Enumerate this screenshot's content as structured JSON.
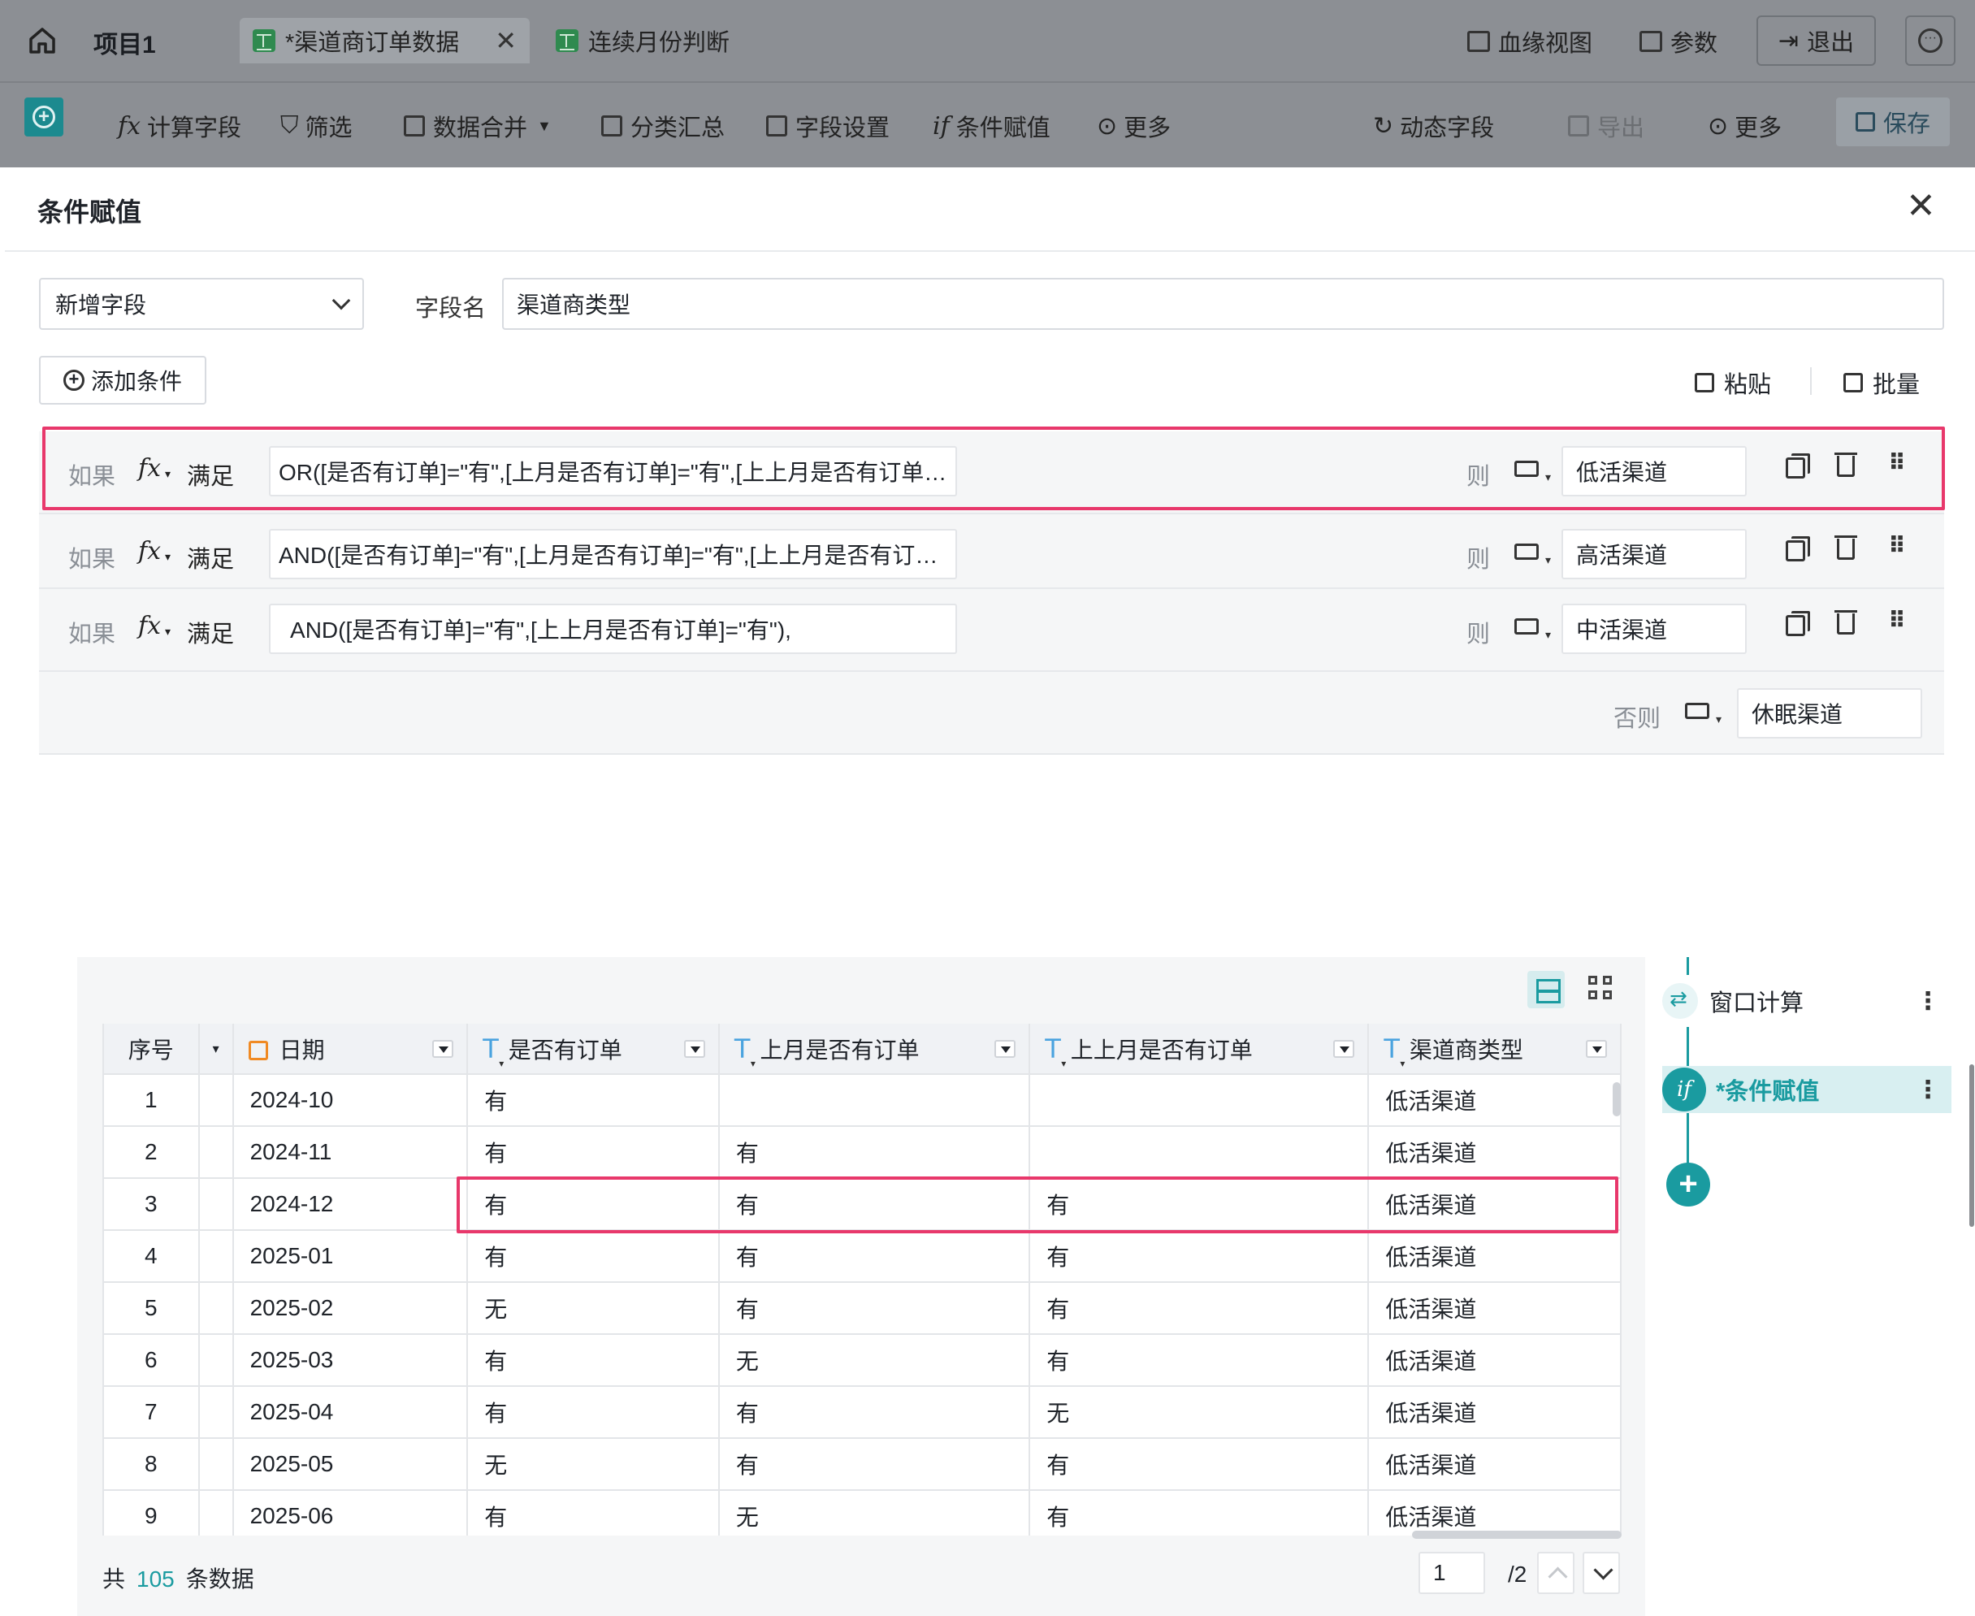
{
  "topbar": {
    "project": "项目1",
    "tabs": [
      {
        "label": "*渠道商订单数据",
        "active": true
      },
      {
        "label": "连续月份判断",
        "active": false
      }
    ],
    "lineage": "血缘视图",
    "params": "参数",
    "exit": "退出"
  },
  "toolbar": {
    "calc_field": "计算字段",
    "filter": "筛选",
    "merge": "数据合并",
    "group_summary": "分类汇总",
    "field_settings": "字段设置",
    "conditional_assign": "条件赋值",
    "more": "更多",
    "dynamic_field": "动态字段",
    "export": "导出",
    "more_right": "更多",
    "save": "保存"
  },
  "dialog": {
    "title": "条件赋值",
    "mode_select": "新增字段",
    "field_name_label": "字段名",
    "field_name_value": "渠道商类型",
    "add_condition": "添加条件",
    "paste": "粘贴",
    "batch": "批量",
    "conditions": [
      {
        "if": "如果",
        "meet": "满足",
        "formula": "OR([是否有订单]=\"有\",[上月是否有订单]=\"有\",[上上月是否有订单…",
        "then": "则",
        "result": "低活渠道"
      },
      {
        "if": "如果",
        "meet": "满足",
        "formula": "AND([是否有订单]=\"有\",[上月是否有订单]=\"有\",[上上月是否有订…",
        "then": "则",
        "result": "高活渠道"
      },
      {
        "if": "如果",
        "meet": "满足",
        "formula": "  AND([是否有订单]=\"有\",[上上月是否有订单]=\"有\"),",
        "then": "则",
        "result": "中活渠道"
      }
    ],
    "else_label": "否则",
    "else_value": "休眠渠道"
  },
  "table": {
    "columns": [
      "序号",
      "日期",
      "是否有订单",
      "上月是否有订单",
      "上上月是否有订单",
      "渠道商类型"
    ],
    "rows": [
      [
        "1",
        "2024-10",
        "有",
        "",
        "",
        "低活渠道"
      ],
      [
        "2",
        "2024-11",
        "有",
        "有",
        "",
        "低活渠道"
      ],
      [
        "3",
        "2024-12",
        "有",
        "有",
        "有",
        "低活渠道"
      ],
      [
        "4",
        "2025-01",
        "有",
        "有",
        "有",
        "低活渠道"
      ],
      [
        "5",
        "2025-02",
        "无",
        "有",
        "有",
        "低活渠道"
      ],
      [
        "6",
        "2025-03",
        "有",
        "无",
        "有",
        "低活渠道"
      ],
      [
        "7",
        "2025-04",
        "有",
        "有",
        "无",
        "低活渠道"
      ],
      [
        "8",
        "2025-05",
        "无",
        "有",
        "有",
        "低活渠道"
      ],
      [
        "9",
        "2025-06",
        "有",
        "无",
        "有",
        "低活渠道"
      ]
    ]
  },
  "footer": {
    "prefix": "共",
    "count": "105",
    "suffix": "条数据",
    "page": "1",
    "total_pages": "/2"
  },
  "steps": [
    {
      "label": "窗口计算",
      "icon": "window-calc-icon"
    },
    {
      "label": "*条件赋值",
      "icon": "conditional-assign-icon",
      "active": true
    }
  ],
  "colors": {
    "accent": "#1a9ba0",
    "highlight": "#e8386b"
  }
}
